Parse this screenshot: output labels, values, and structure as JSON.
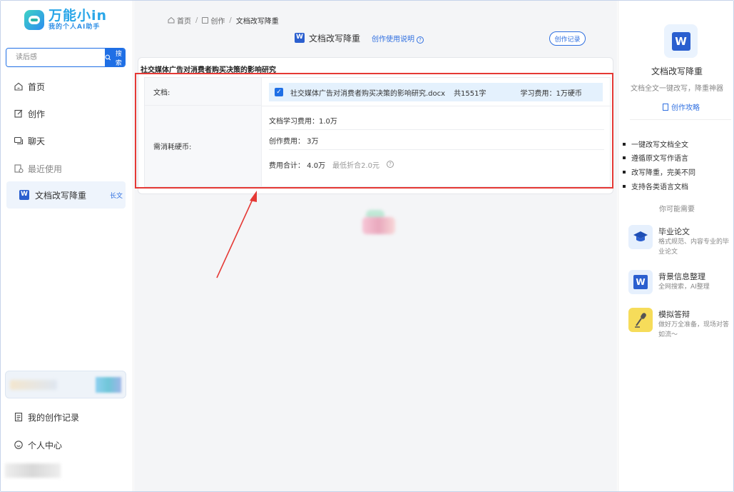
{
  "sidebar": {
    "logo_title": "万能小in",
    "logo_sub": "我的个人AI助手",
    "search_placeholder": "读后感",
    "search_button": "搜索",
    "nav": [
      {
        "label": "首页"
      },
      {
        "label": "创作"
      },
      {
        "label": "聊天"
      },
      {
        "label": "最近使用"
      }
    ],
    "recent_tool": {
      "label": "文档改写降重",
      "tag": "长文"
    },
    "bottom_nav": [
      {
        "label": "我的创作记录"
      },
      {
        "label": "个人中心"
      }
    ]
  },
  "main": {
    "breadcrumb": {
      "home": "首页",
      "create": "创作",
      "current": "文档改写降重"
    },
    "tool_title": "文档改写降重",
    "help_link": "创作使用说明",
    "history_button": "创作记录",
    "card_title": "社交媒体广告对消费者购买决策的影响研究",
    "doc_label": "文档:",
    "doc_file": "社交媒体广告对消费者购买决策的影响研究.docx",
    "doc_words": "共1551字",
    "doc_fee": "学习费用：1万硬币",
    "cost_label": "需消耗硬币:",
    "cost_learn": "文档学习费用：1.0万",
    "cost_create": "创作费用：  3万",
    "cost_total": "费用合计：  4.0万",
    "cost_min": "最低折合2.0元"
  },
  "right": {
    "title": "文档改写降重",
    "subtitle": "文档全文一键改写，降重神器",
    "guide": "创作攻略",
    "features": [
      "一键改写文档全文",
      "遵循原文写作语言",
      "改写降重，完美不同",
      "支持各类语言文档"
    ],
    "may_need": "你可能需要",
    "recommends": [
      {
        "name": "毕业论文",
        "desc": "格式规范、内容专业的毕业论文"
      },
      {
        "name": "背景信息整理",
        "desc": "全网搜索，AI整理"
      },
      {
        "name": "模拟答辩",
        "desc": "做好万全准备，现场对答如流～"
      }
    ]
  },
  "colors": {
    "primary": "#1f6fe5",
    "highlight": "#e53935",
    "word": "#2b5fcf"
  }
}
